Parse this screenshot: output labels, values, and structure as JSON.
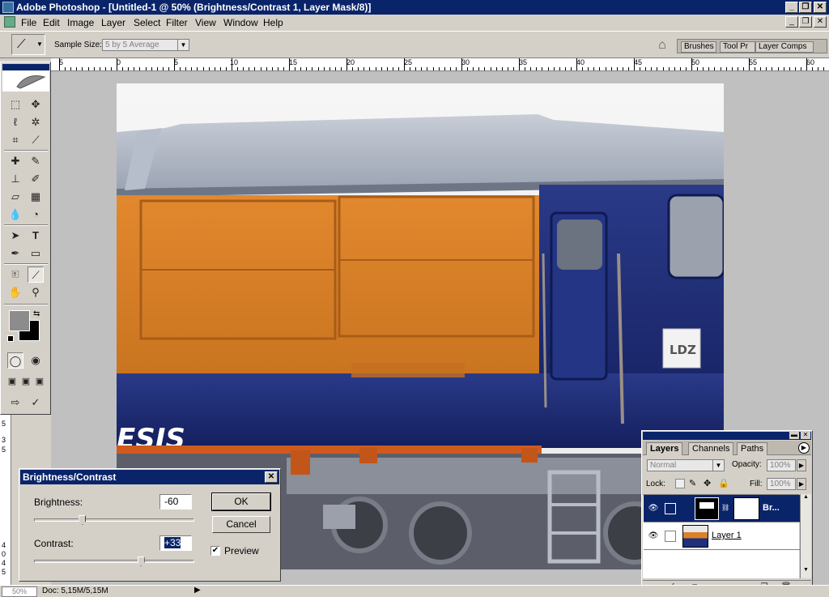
{
  "window": {
    "title": "Adobe Photoshop - [Untitled-1 @ 50% (Brightness/Contrast 1, Layer Mask/8)]"
  },
  "menu": [
    "File",
    "Edit",
    "Image",
    "Layer",
    "Select",
    "Filter",
    "View",
    "Window",
    "Help"
  ],
  "options": {
    "sample_size_label": "Sample Size:",
    "sample_size_value": "5 by 5 Average"
  },
  "palette_well": [
    "Brushes",
    "Tool Pr",
    "Layer Comps"
  ],
  "ruler_top": [
    "5",
    "0",
    "5",
    "10",
    "15",
    "20",
    "25",
    "30",
    "35",
    "40",
    "45",
    "50",
    "55",
    "60"
  ],
  "ruler_left": [
    "5",
    "3",
    "5",
    "4",
    "0",
    "4",
    "5"
  ],
  "status": {
    "zoom": "50%",
    "doc": "Doc: 5,15M/5,15M"
  },
  "dialog": {
    "title": "Brightness/Contrast",
    "brightness_label": "Brightness:",
    "brightness_value": "-60",
    "brightness_level": -60,
    "contrast_label": "Contrast:",
    "contrast_value": "+33",
    "contrast_level": 33,
    "ok": "OK",
    "cancel": "Cancel",
    "preview_label": "Preview",
    "preview_checked": true
  },
  "layers_panel": {
    "tabs": [
      "Layers",
      "Channels",
      "Paths"
    ],
    "blend_mode": "Normal",
    "opacity_label": "Opacity:",
    "opacity_value": "100%",
    "lock_label": "Lock:",
    "fill_label": "Fill:",
    "fill_value": "100%",
    "layers": [
      {
        "name": "Br...",
        "selected": true
      },
      {
        "name": "Layer 1",
        "selected": false
      }
    ]
  },
  "photo": {
    "logo_text": "LDZ",
    "side_text": "ESIS"
  },
  "colors": {
    "accent": "#0a246a",
    "train_orange": "#d9822b",
    "train_blue": "#1f2f7a"
  }
}
